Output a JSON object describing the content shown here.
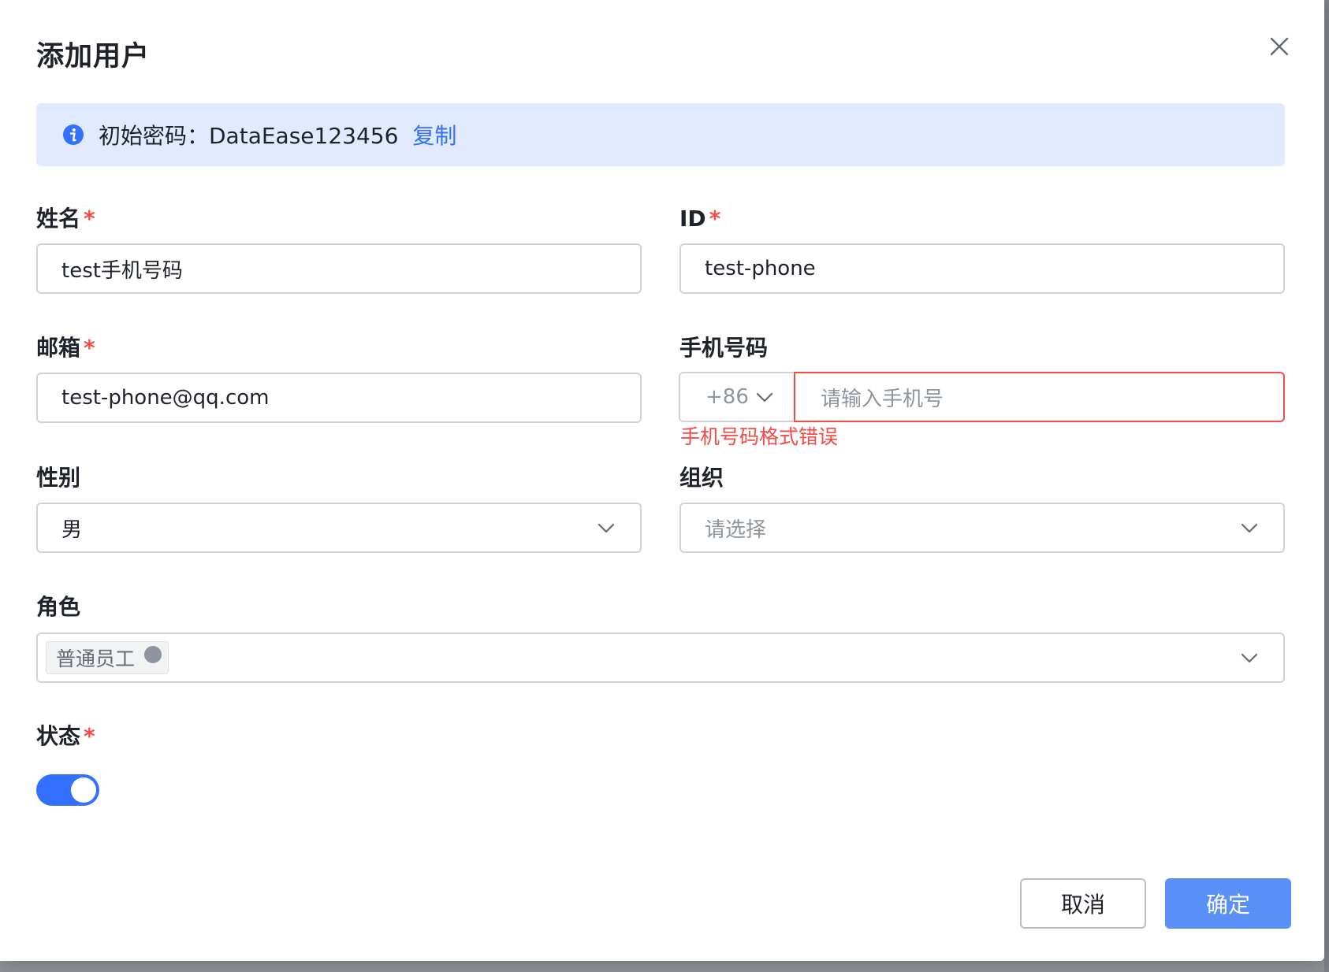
{
  "dialog": {
    "title": "添加用户",
    "notice": {
      "label": "初始密码：DataEase123456",
      "copy_label": "复制"
    }
  },
  "form": {
    "name": {
      "label": "姓名",
      "required": "*",
      "value": "test手机号码"
    },
    "id": {
      "label": "ID",
      "required": "*",
      "value": "test-phone"
    },
    "email": {
      "label": "邮箱",
      "required": "*",
      "value": "test-phone@qq.com"
    },
    "phone": {
      "label": "手机号码",
      "prefix": "+86",
      "placeholder": "请输入手机号",
      "error": "手机号码格式错误"
    },
    "gender": {
      "label": "性别",
      "value": "男"
    },
    "org": {
      "label": "组织",
      "placeholder": "请选择"
    },
    "role": {
      "label": "角色",
      "tags": [
        "普通员工"
      ]
    },
    "status": {
      "label": "状态",
      "required": "*",
      "enabled": true
    }
  },
  "footer": {
    "cancel_label": "取消",
    "confirm_label": "确定"
  },
  "colors": {
    "accent": "#3370ff",
    "error": "#f54a45",
    "notice_bg": "#e1eaff",
    "confirm_bg": "#5b8ff9"
  },
  "icons": {
    "close": "close-icon",
    "info": "info-icon",
    "chevron": "chevron-down-icon"
  }
}
